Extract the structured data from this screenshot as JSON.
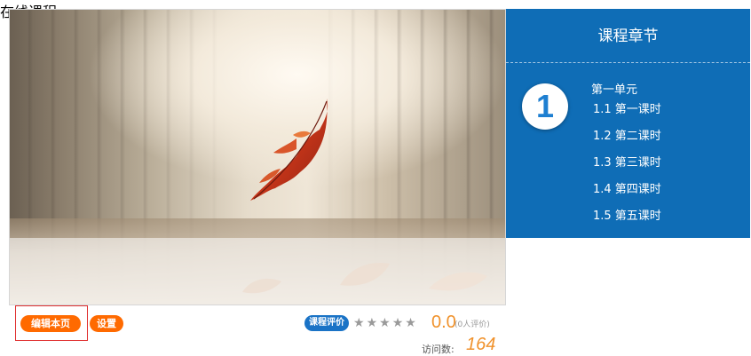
{
  "course": {
    "title": "在线课程"
  },
  "actions": {
    "edit_label": "编辑本页",
    "settings_label": "设置"
  },
  "rating": {
    "badge_label": "课程评价",
    "stars_total": 5,
    "stars_filled": 0,
    "score": "0.0",
    "review_count": "(0人评价)"
  },
  "visits": {
    "label": "访问数:",
    "value": "164"
  },
  "chapters": {
    "header": "课程章节",
    "unit_number": "1",
    "unit_title": "第一单元",
    "lessons": [
      "1.1  第一课时",
      "1.2  第二课时",
      "1.3  第三课时",
      "1.4  第四课时",
      "1.5  第五课时"
    ]
  },
  "colors": {
    "accent_orange": "#ff6a00",
    "panel_blue": "#0f6db6",
    "badge_blue": "#1a73c6",
    "score_orange": "#f0922c"
  }
}
